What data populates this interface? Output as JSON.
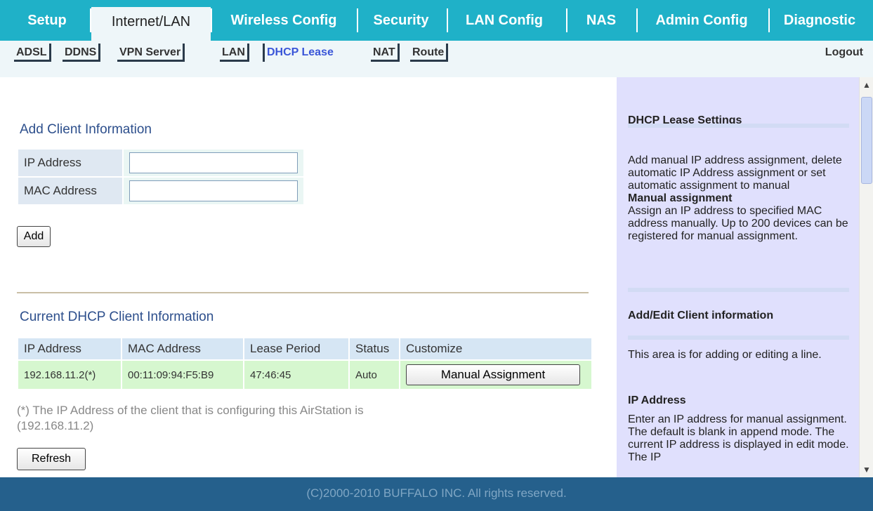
{
  "main_nav": {
    "tabs": [
      {
        "label": "Setup",
        "active": false
      },
      {
        "label": "Internet/LAN",
        "active": true
      },
      {
        "label": "Wireless Config",
        "active": false
      },
      {
        "label": "Security",
        "active": false
      },
      {
        "label": "LAN Config",
        "active": false
      },
      {
        "label": "NAS",
        "active": false
      },
      {
        "label": "Admin Config",
        "active": false
      },
      {
        "label": "Diagnostic",
        "active": false
      }
    ]
  },
  "sub_nav": {
    "items": [
      {
        "label": "ADSL",
        "active": false
      },
      {
        "label": "DDNS",
        "active": false
      },
      {
        "label": "VPN Server",
        "active": false
      },
      {
        "label": "LAN",
        "active": false
      },
      {
        "label": "DHCP Lease",
        "active": true
      },
      {
        "label": "NAT",
        "active": false
      },
      {
        "label": "Route",
        "active": false
      }
    ],
    "logout": "Logout"
  },
  "add_client": {
    "title": "Add Client Information",
    "ip_label": "IP Address",
    "ip_value": "",
    "mac_label": "MAC Address",
    "mac_value": "",
    "add_button": "Add"
  },
  "current_clients": {
    "title": "Current DHCP Client Information",
    "headers": [
      "IP Address",
      "MAC Address",
      "Lease Period",
      "Status",
      "Customize"
    ],
    "rows": [
      {
        "ip": "192.168.11.2(*)",
        "mac": "00:11:09:94:F5:B9",
        "lease": "47:46:45",
        "status": "Auto",
        "action": "Manual Assignment"
      }
    ],
    "note_line1": "(*) The IP Address of the client that is configuring this AirStation is",
    "note_line2": "(192.168.11.2)",
    "refresh_button": "Refresh"
  },
  "help": {
    "sections": [
      {
        "heading": "DHCP Lease Settings",
        "text": "Add manual IP address assignment, delete automatic IP Address assignment or set automatic assignment to manual",
        "subheading": "Manual assignment",
        "subtext": "Assign an IP address to specified MAC address manually. Up to 200 devices can be registered for manual assignment."
      },
      {
        "heading": "Add/Edit Client information",
        "text": "This area is for adding or editing a line."
      },
      {
        "heading": "IP Address",
        "text": "Enter an IP address for manual assignment. The default is blank in append mode. The current IP address is displayed in edit mode. The IP"
      }
    ]
  },
  "footer": {
    "copyright": "(C)2000-2010 BUFFALO INC. All rights reserved."
  },
  "colors": {
    "nav_bg": "#1fb1c8",
    "subnav_bg": "#eef6f9",
    "active_sub": "#3a56d8",
    "section_title": "#2d4f8c",
    "help_bg": "#e0e0fd",
    "footer_bg": "#25608c",
    "lease_row_bg": "#d6f7cf"
  }
}
